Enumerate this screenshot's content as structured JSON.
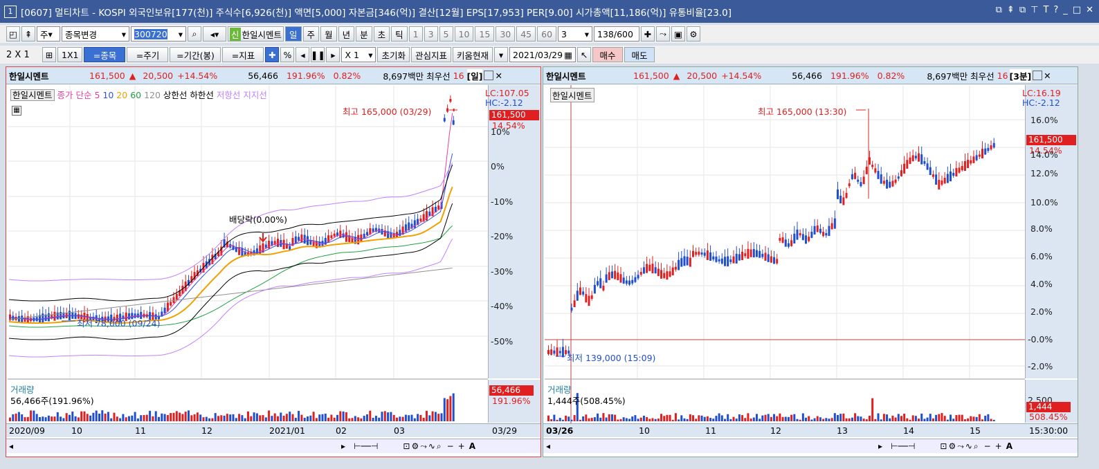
{
  "window": {
    "num": "1",
    "title": "[0607] 멀티차트 - KOSPI 외국인보유[177(천)] 주식수[6,926(천)] 액면[5,000] 자본금[346(억)] 결산[12월] EPS[17,953] PER[9.00] 시가총액[11,186(억)] 유통비율[23.0]",
    "controls": [
      "⧉",
      "⇞",
      "⧉",
      "⊤",
      "T",
      "?",
      "_",
      "□",
      "✕"
    ]
  },
  "toolbar1": {
    "type_select": "주",
    "stock_change": "종목변경",
    "code": "300720",
    "new_badge": "신",
    "stock_name": "한일시멘트",
    "periods": [
      "일",
      "주",
      "월",
      "년",
      "분",
      "초",
      "틱"
    ],
    "nums": [
      "1",
      "3",
      "5",
      "10",
      "15",
      "30",
      "45",
      "60"
    ],
    "count_select": "3",
    "page": "138/600"
  },
  "toolbar2": {
    "layout": "2 X 1",
    "one": "1X1",
    "btn_item": "=종목",
    "btn_period": "=주기",
    "btn_range": "=기간(봉)",
    "btn_index": "=지표",
    "pct": "%",
    "multiplier": "X 1",
    "init": "초기화",
    "fav": "관심지표",
    "kiwoom": "키움현재",
    "date": "2021/03/29",
    "buy": "매수",
    "sell": "매도"
  },
  "left": {
    "header": {
      "name": "한일시멘트",
      "price": "161,500",
      "arrow": "▲",
      "change": "20,500",
      "pct": "+14.54%",
      "volume": "56,466",
      "vol_pct": "191.96%",
      "ratio": "0.82%",
      "amount": "8,697백만",
      "pref": "최우선",
      "pref_n": "16",
      "period": "[일]"
    },
    "legend": {
      "name": "한일시멘트",
      "ma_label": "종가 단순",
      "ma": [
        "5",
        "10",
        "20",
        "60",
        "120"
      ],
      "upper": "상한선",
      "lower": "하한선",
      "resist": "저항선",
      "support": "지지선"
    },
    "lc": "LC:107.05",
    "hc": "HC:-2.12",
    "price_box": "161,500",
    "price_pct": "14.54%",
    "high_label": "최고 165,000 (03/29)",
    "low_label": "최저 78,000 (09/24)",
    "dividend": "배당락(0.00%)",
    "yticks": [
      "10%",
      "0%",
      "-10%",
      "-20%",
      "-30%",
      "-40%",
      "-50%"
    ],
    "vol_title": "거래량",
    "vol_value": "56,466주(191.96%)",
    "vol_box": "56,466",
    "vol_box_pct": "191.96%",
    "xticks": [
      "2020/09",
      "10",
      "11",
      "12",
      "2021/01",
      "02",
      "03"
    ],
    "xend": "03/29"
  },
  "right": {
    "header": {
      "name": "한일시멘트",
      "price": "161,500",
      "arrow": "▲",
      "change": "20,500",
      "pct": "+14.54%",
      "volume": "56,466",
      "vol_pct": "191.96%",
      "ratio": "0.82%",
      "amount": "8,697백만",
      "pref": "최우선",
      "pref_n": "16",
      "period": "[3분]"
    },
    "legend": {
      "name": "한일시멘트"
    },
    "lc": "LC:16.19",
    "hc": "HC:-2.12",
    "price_box": "161,500",
    "price_pct": "14.54%",
    "high_label": "최고 165,000 (13:30)",
    "low_label": "최저 139,000 (15:09)",
    "yticks": [
      "16.0%",
      "14.0%",
      "12.0%",
      "10.0%",
      "8.0%",
      "6.0%",
      "4.0%",
      "2.0%",
      "-0.0%",
      "-2.0%"
    ],
    "vol_title": "거래량",
    "vol_value": "1,444주(508.45%)",
    "vol_tick": "2,500",
    "vol_box": "1,444",
    "vol_box_pct": "508.45%",
    "xticks": [
      "03/26",
      "10",
      "11",
      "12",
      "13",
      "14",
      "15"
    ],
    "xend": "15:30:00"
  },
  "colors": {
    "up": "#e02020",
    "down": "#1f4fd0",
    "ma5": "#e040a0",
    "ma10": "#3050e0",
    "ma20": "#f0a000",
    "ma60": "#20a040",
    "ma120": "#909090",
    "band": "#000000",
    "envelope": "#c080ff"
  }
}
